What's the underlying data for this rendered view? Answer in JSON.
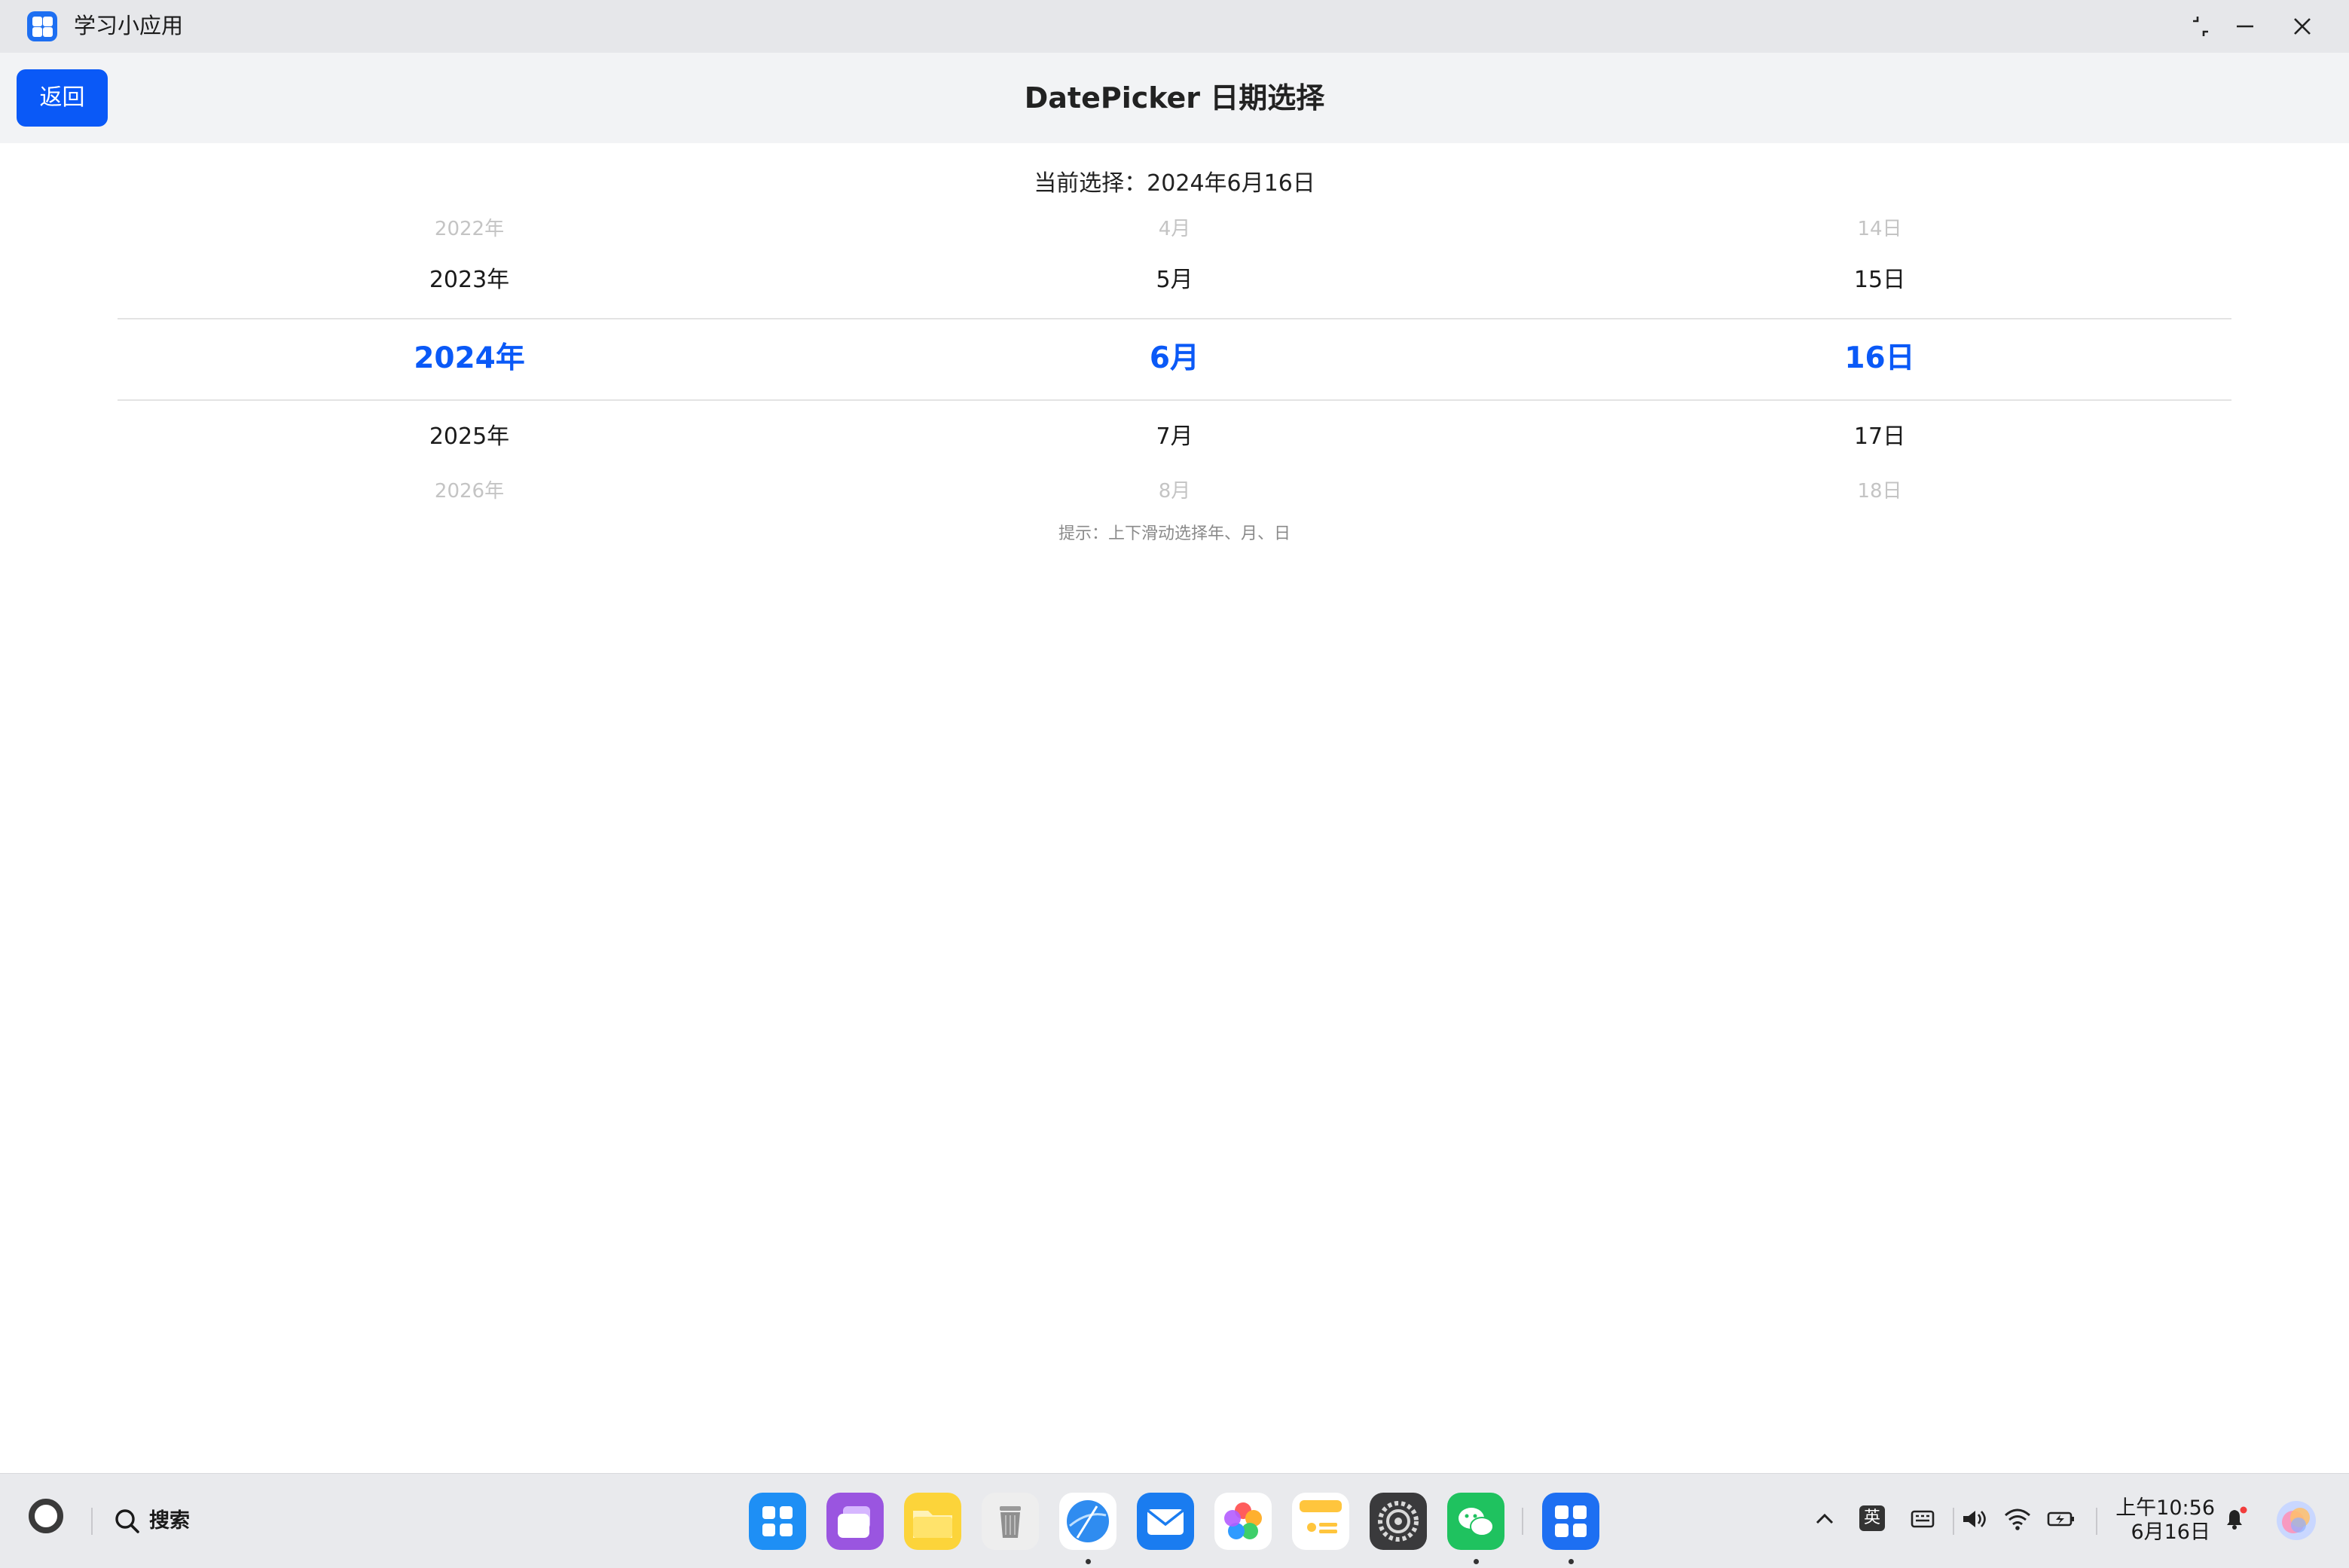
{
  "window": {
    "app_name": "学习小应用",
    "controls": [
      "restore-icon",
      "minimize-icon",
      "close-icon"
    ]
  },
  "header": {
    "back_label": "返回",
    "title": "DatePicker 日期选择"
  },
  "main": {
    "current_selection": "当前选择：2024年6月16日",
    "hint": "提示：上下滑动选择年、月、日"
  },
  "picker": {
    "year": {
      "above2": "2022年",
      "above1": "2023年",
      "selected": "2024年",
      "below1": "2025年",
      "below2": "2026年"
    },
    "month": {
      "above2": "4月",
      "above1": "5月",
      "selected": "6月",
      "below1": "7月",
      "below2": "8月"
    },
    "day": {
      "above2": "14日",
      "above1": "15日",
      "selected": "16日",
      "below1": "17日",
      "below2": "18日"
    }
  },
  "taskbar": {
    "search_label": "搜索",
    "dock": [
      "launcher-icon",
      "multitask-icon",
      "files-icon",
      "trash-icon",
      "browser-icon",
      "mail-icon",
      "gallery-icon",
      "notes-icon",
      "settings-icon",
      "wechat-icon",
      "study-app-icon"
    ],
    "ime_label": "英",
    "time": "上午10:56",
    "date": "6月16日"
  },
  "colors": {
    "accent": "#0a59f7",
    "titlebar": "#e6e7ea",
    "header": "#f2f3f5",
    "taskbar": "#e9eaed"
  }
}
